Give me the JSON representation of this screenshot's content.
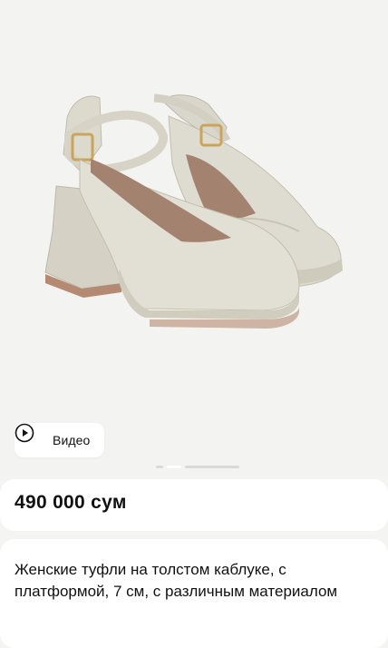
{
  "product": {
    "image_alt": "product-photo",
    "video_button_label": "Видео",
    "price": "490 000 сум",
    "title": "Женские туфли на толстом каблуке, с платформой, 7 см, с различным материалом"
  },
  "gallery": {
    "pages": 2,
    "active_page": 2
  },
  "colors": {
    "background": "#f4f4f2",
    "card": "#ffffff",
    "shoe": "#dedcd0",
    "text": "#111111"
  }
}
